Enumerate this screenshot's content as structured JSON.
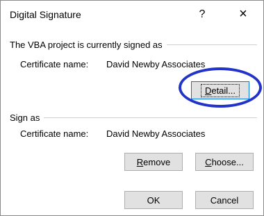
{
  "window": {
    "title": "Digital Signature",
    "help_label": "?",
    "close_label": "×"
  },
  "signed_section": {
    "header": "The VBA project is currently signed as",
    "cert_label": "Certificate name:",
    "cert_value": "David Newby Associates",
    "detail_button": {
      "underlined": "D",
      "rest": "etail..."
    }
  },
  "sign_as_section": {
    "header": "Sign as",
    "cert_label": "Certificate name:",
    "cert_value": "David Newby Associates",
    "remove_button": {
      "underlined": "R",
      "rest": "emove"
    },
    "choose_button": {
      "underlined": "C",
      "rest": "hoose..."
    }
  },
  "footer": {
    "ok_label": "OK",
    "cancel_label": "Cancel"
  },
  "annotation": {
    "color": "#2234c8",
    "shape": "oval"
  }
}
